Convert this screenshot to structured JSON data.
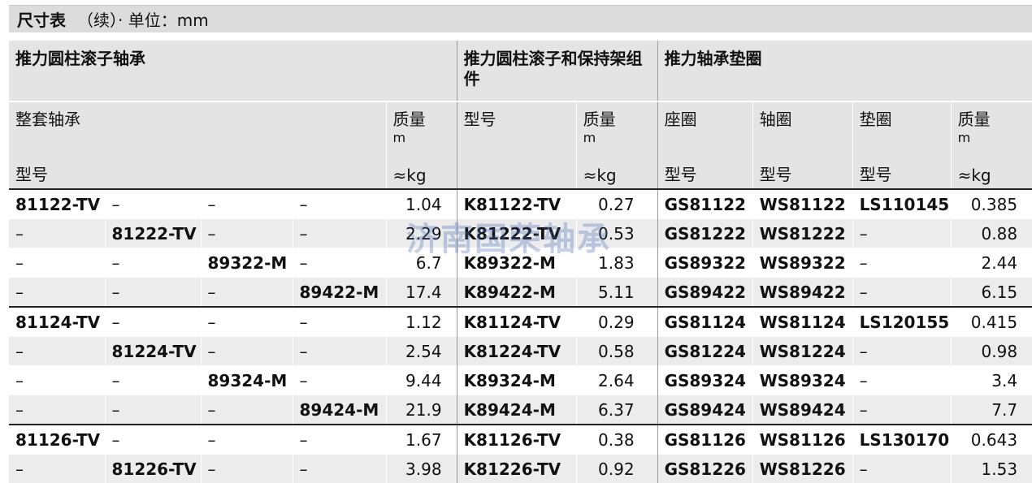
{
  "title": {
    "bold": "尺寸表",
    "rest": "（续）· 单位：mm"
  },
  "groups": {
    "g1": "推力圆柱滚子轴承",
    "g2": "推力圆柱滚子和保持架组件",
    "g3": "推力轴承垫圈"
  },
  "headers": {
    "full_set": "整套轴承",
    "model": "型号",
    "mass": "质量",
    "mass_sym": "m",
    "mass_unit": "≈kg",
    "housing_washer": "座圈",
    "shaft_washer": "轴圈",
    "washer": "垫圈"
  },
  "rows": [
    [
      "81122-TV",
      "–",
      "–",
      "–",
      "1.04",
      "K81122-TV",
      "0.27",
      "GS81122",
      "WS81122",
      "LS110145",
      "0.385"
    ],
    [
      "–",
      "81222-TV",
      "–",
      "–",
      "2.29",
      "K81222-TV",
      "0.53",
      "GS81222",
      "WS81222",
      "–",
      "0.88"
    ],
    [
      "–",
      "–",
      "89322-M",
      "–",
      "6.7",
      "K89322-M",
      "1.83",
      "GS89322",
      "WS89322",
      "–",
      "2.44"
    ],
    [
      "–",
      "–",
      "–",
      "89422-M",
      "17.4",
      "K89422-M",
      "5.11",
      "GS89422",
      "WS89422",
      "–",
      "6.15"
    ],
    [
      "81124-TV",
      "–",
      "–",
      "–",
      "1.12",
      "K81124-TV",
      "0.29",
      "GS81124",
      "WS81124",
      "LS120155",
      "0.415"
    ],
    [
      "–",
      "81224-TV",
      "–",
      "–",
      "2.54",
      "K81224-TV",
      "0.58",
      "GS81224",
      "WS81224",
      "–",
      "0.98"
    ],
    [
      "–",
      "–",
      "89324-M",
      "–",
      "9.44",
      "K89324-M",
      "2.64",
      "GS89324",
      "WS89324",
      "–",
      "3.4"
    ],
    [
      "–",
      "–",
      "–",
      "89424-M",
      "21.9",
      "K89424-M",
      "6.37",
      "GS89424",
      "WS89424",
      "–",
      "7.7"
    ],
    [
      "81126-TV",
      "–",
      "–",
      "–",
      "1.67",
      "K81126-TV",
      "0.38",
      "GS81126",
      "WS81126",
      "LS130170",
      "0.643"
    ],
    [
      "–",
      "81226-TV",
      "–",
      "–",
      "3.98",
      "K81226-TV",
      "0.92",
      "GS81226",
      "WS81226",
      "–",
      "1.53"
    ]
  ],
  "watermark": "济南国荣轴承"
}
